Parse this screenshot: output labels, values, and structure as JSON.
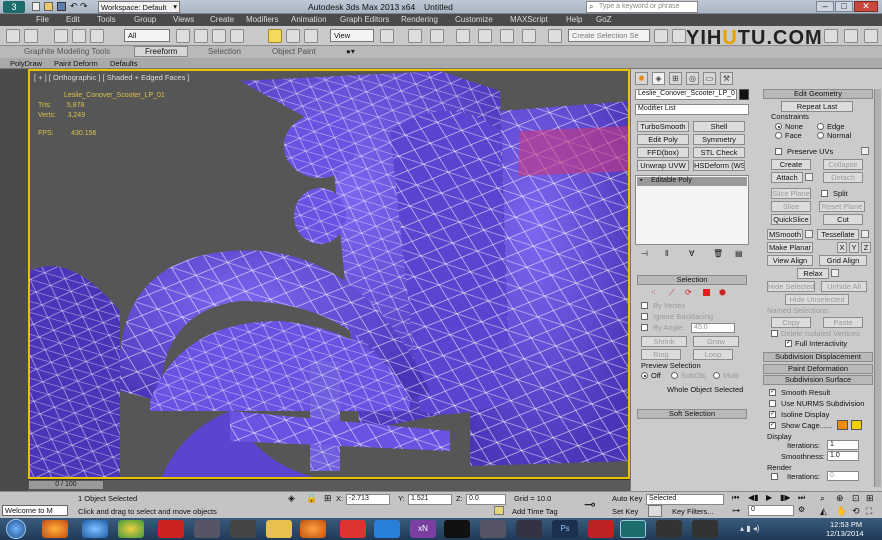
{
  "title_bar": {
    "workspace": "Workspace: Default",
    "app_title": "Autodesk 3ds Max  2013 x64",
    "doc_title": "Untitled",
    "search_placeholder": "Type a keyword or phrase"
  },
  "menu": [
    "File",
    "Edit",
    "Tools",
    "Group",
    "Views",
    "Create",
    "Modifiers",
    "Animation",
    "Graph Editors",
    "Rendering",
    "Customize",
    "MAXScript",
    "Help",
    "GoZ"
  ],
  "toolbar": {
    "filter_value": "All",
    "view_value": "View",
    "selection_set_placeholder": "Create Selection Se"
  },
  "watermark": {
    "part1": "YIH",
    "part2": "U",
    "part3": "TU.COM"
  },
  "ribbon": {
    "tabs": [
      "Graphite Modeling Tools",
      "Freeform",
      "Selection",
      "Object Paint"
    ],
    "sub_tabs": [
      "PolyDraw",
      "Paint Deform",
      "Defaults"
    ]
  },
  "viewport": {
    "label": "[ + ] [ Orthographic ] [ Shaded + Edged Faces ]",
    "object_name": "Leslie_Conover_Scooter_LP_01",
    "tris_label": "Tris:",
    "tris_value": "5,878",
    "verts_label": "Verts:",
    "verts_value": "3,249",
    "fps_label": "FPS:",
    "fps_value": "430.156",
    "mesh_color": "#6b4fd8",
    "wire_color": "#ffffff"
  },
  "timeline": {
    "frame": "0 / 100"
  },
  "command_panel": {
    "object_name_field": "Leslie_Conover_Scooter_LP_0",
    "modifier_list": "Modifier List",
    "modifier_buttons": [
      "TurboSmooth",
      "Shell",
      "Edit Poly",
      "Symmetry",
      "FFD(box)",
      "STL Check",
      "Unwrap UVW",
      "HSDeform (WS"
    ],
    "stack_item": "Editable Poly",
    "selection": {
      "header": "Selection",
      "by_vertex": "By Vertex",
      "ignore_backfacing": "Ignore Backfacing",
      "by_angle": "By Angle:",
      "angle_value": "45.0",
      "shrink": "Shrink",
      "grow": "Grow",
      "ring": "Ring",
      "loop": "Loop",
      "preview_selection": "Preview Selection",
      "preview_off": "Off",
      "preview_subobj": "SubObj",
      "preview_multi": "Multi",
      "status": "Whole Object Selected"
    },
    "soft_selection": "Soft Selection",
    "edit_geometry": {
      "header": "Edit Geometry",
      "repeat_last": "Repeat Last",
      "constraints": "Constraints",
      "none": "None",
      "edge": "Edge",
      "face": "Face",
      "normal": "Normal",
      "preserve_uvs": "Preserve UVs",
      "create": "Create",
      "collapse": "Collapse",
      "attach": "Attach",
      "detach": "Detach",
      "slice_plane": "Slice Plane",
      "split": "Split",
      "slice": "Slice",
      "reset_plane": "Reset Plane",
      "quickslice": "QuickSlice",
      "cut": "Cut",
      "msmooth": "MSmooth",
      "tessellate": "Tessellate",
      "make_planar": "Make Planar",
      "x": "X",
      "y": "Y",
      "z": "Z",
      "view_align": "View Align",
      "grid_align": "Grid Align",
      "relax": "Relax",
      "hide_selected": "Hide Selected",
      "unhide_all": "Unhide All",
      "hide_unselected": "Hide Unselected",
      "named_selections": "Named Selections:",
      "copy": "Copy",
      "paste": "Paste",
      "delete_isolated": "Delete Isolated Vertices",
      "full_interactivity": "Full Interactivity"
    },
    "subdivision_displacement": "Subdivision Displacement",
    "paint_deformation": "Paint Deformation",
    "subdivision_surface": {
      "header": "Subdivision Surface",
      "smooth_result": "Smooth Result",
      "use_nurms": "Use NURMS Subdivision",
      "isoline_display": "Isoline Display",
      "show_cage": "Show Cage......",
      "cage_color1": "#f08c00",
      "cage_color2": "#f0d000",
      "display": "Display",
      "iterations_label": "Iterations:",
      "iterations_value": "1",
      "smoothness_label": "Smoothness:",
      "smoothness_value": "1.0",
      "render": "Render",
      "render_iterations": "Iterations:",
      "render_iterations_value": "0"
    }
  },
  "status": {
    "maxscript": "Welcome to M",
    "objects_selected": "1 Object Selected",
    "prompt": "Click and drag to select and move objects",
    "x_label": "X:",
    "x_value": "-2.713",
    "y_label": "Y:",
    "y_value": "1.521",
    "z_label": "Z:",
    "z_value": "0.0",
    "grid": "Grid = 10.0",
    "add_time_tag": "Add Time Tag",
    "auto_key": "Auto Key",
    "set_key": "Set Key",
    "key_mode": "Selected",
    "key_filters": "Key Filters...",
    "frame_value": "0"
  },
  "taskbar": {
    "time": "12:53 PM",
    "date": "12/13/2014"
  }
}
